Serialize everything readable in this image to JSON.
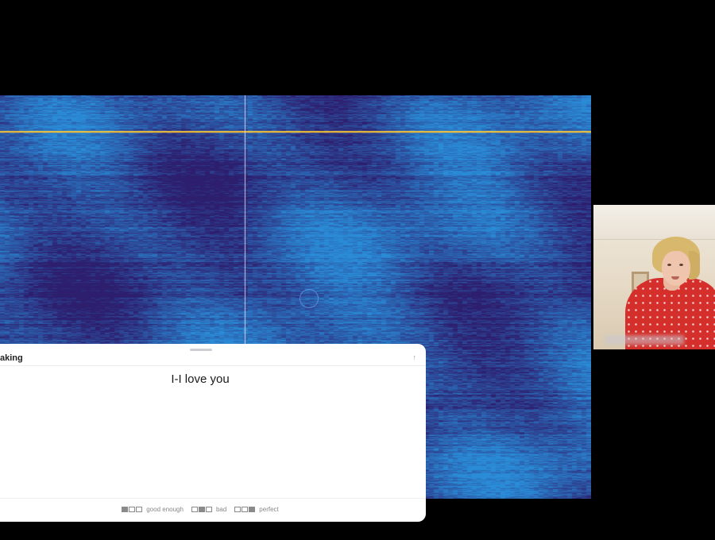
{
  "panel": {
    "title": "aking",
    "transcript": "I-I love you",
    "ratings": [
      {
        "label": "good enough",
        "filled": [
          true,
          false,
          false
        ]
      },
      {
        "label": "bad",
        "filled": [
          false,
          true,
          false
        ]
      },
      {
        "label": "perfect",
        "filled": [
          false,
          false,
          true
        ]
      }
    ]
  },
  "icons": {
    "collapse": "arrow-up-icon",
    "cursor": "cursor-ring-icon"
  },
  "colors": {
    "spectrogram_low": "#2d1e6e",
    "spectrogram_high": "#2a9fd8",
    "marker_line": "#ffc733",
    "panel_bg": "#ffffff"
  }
}
